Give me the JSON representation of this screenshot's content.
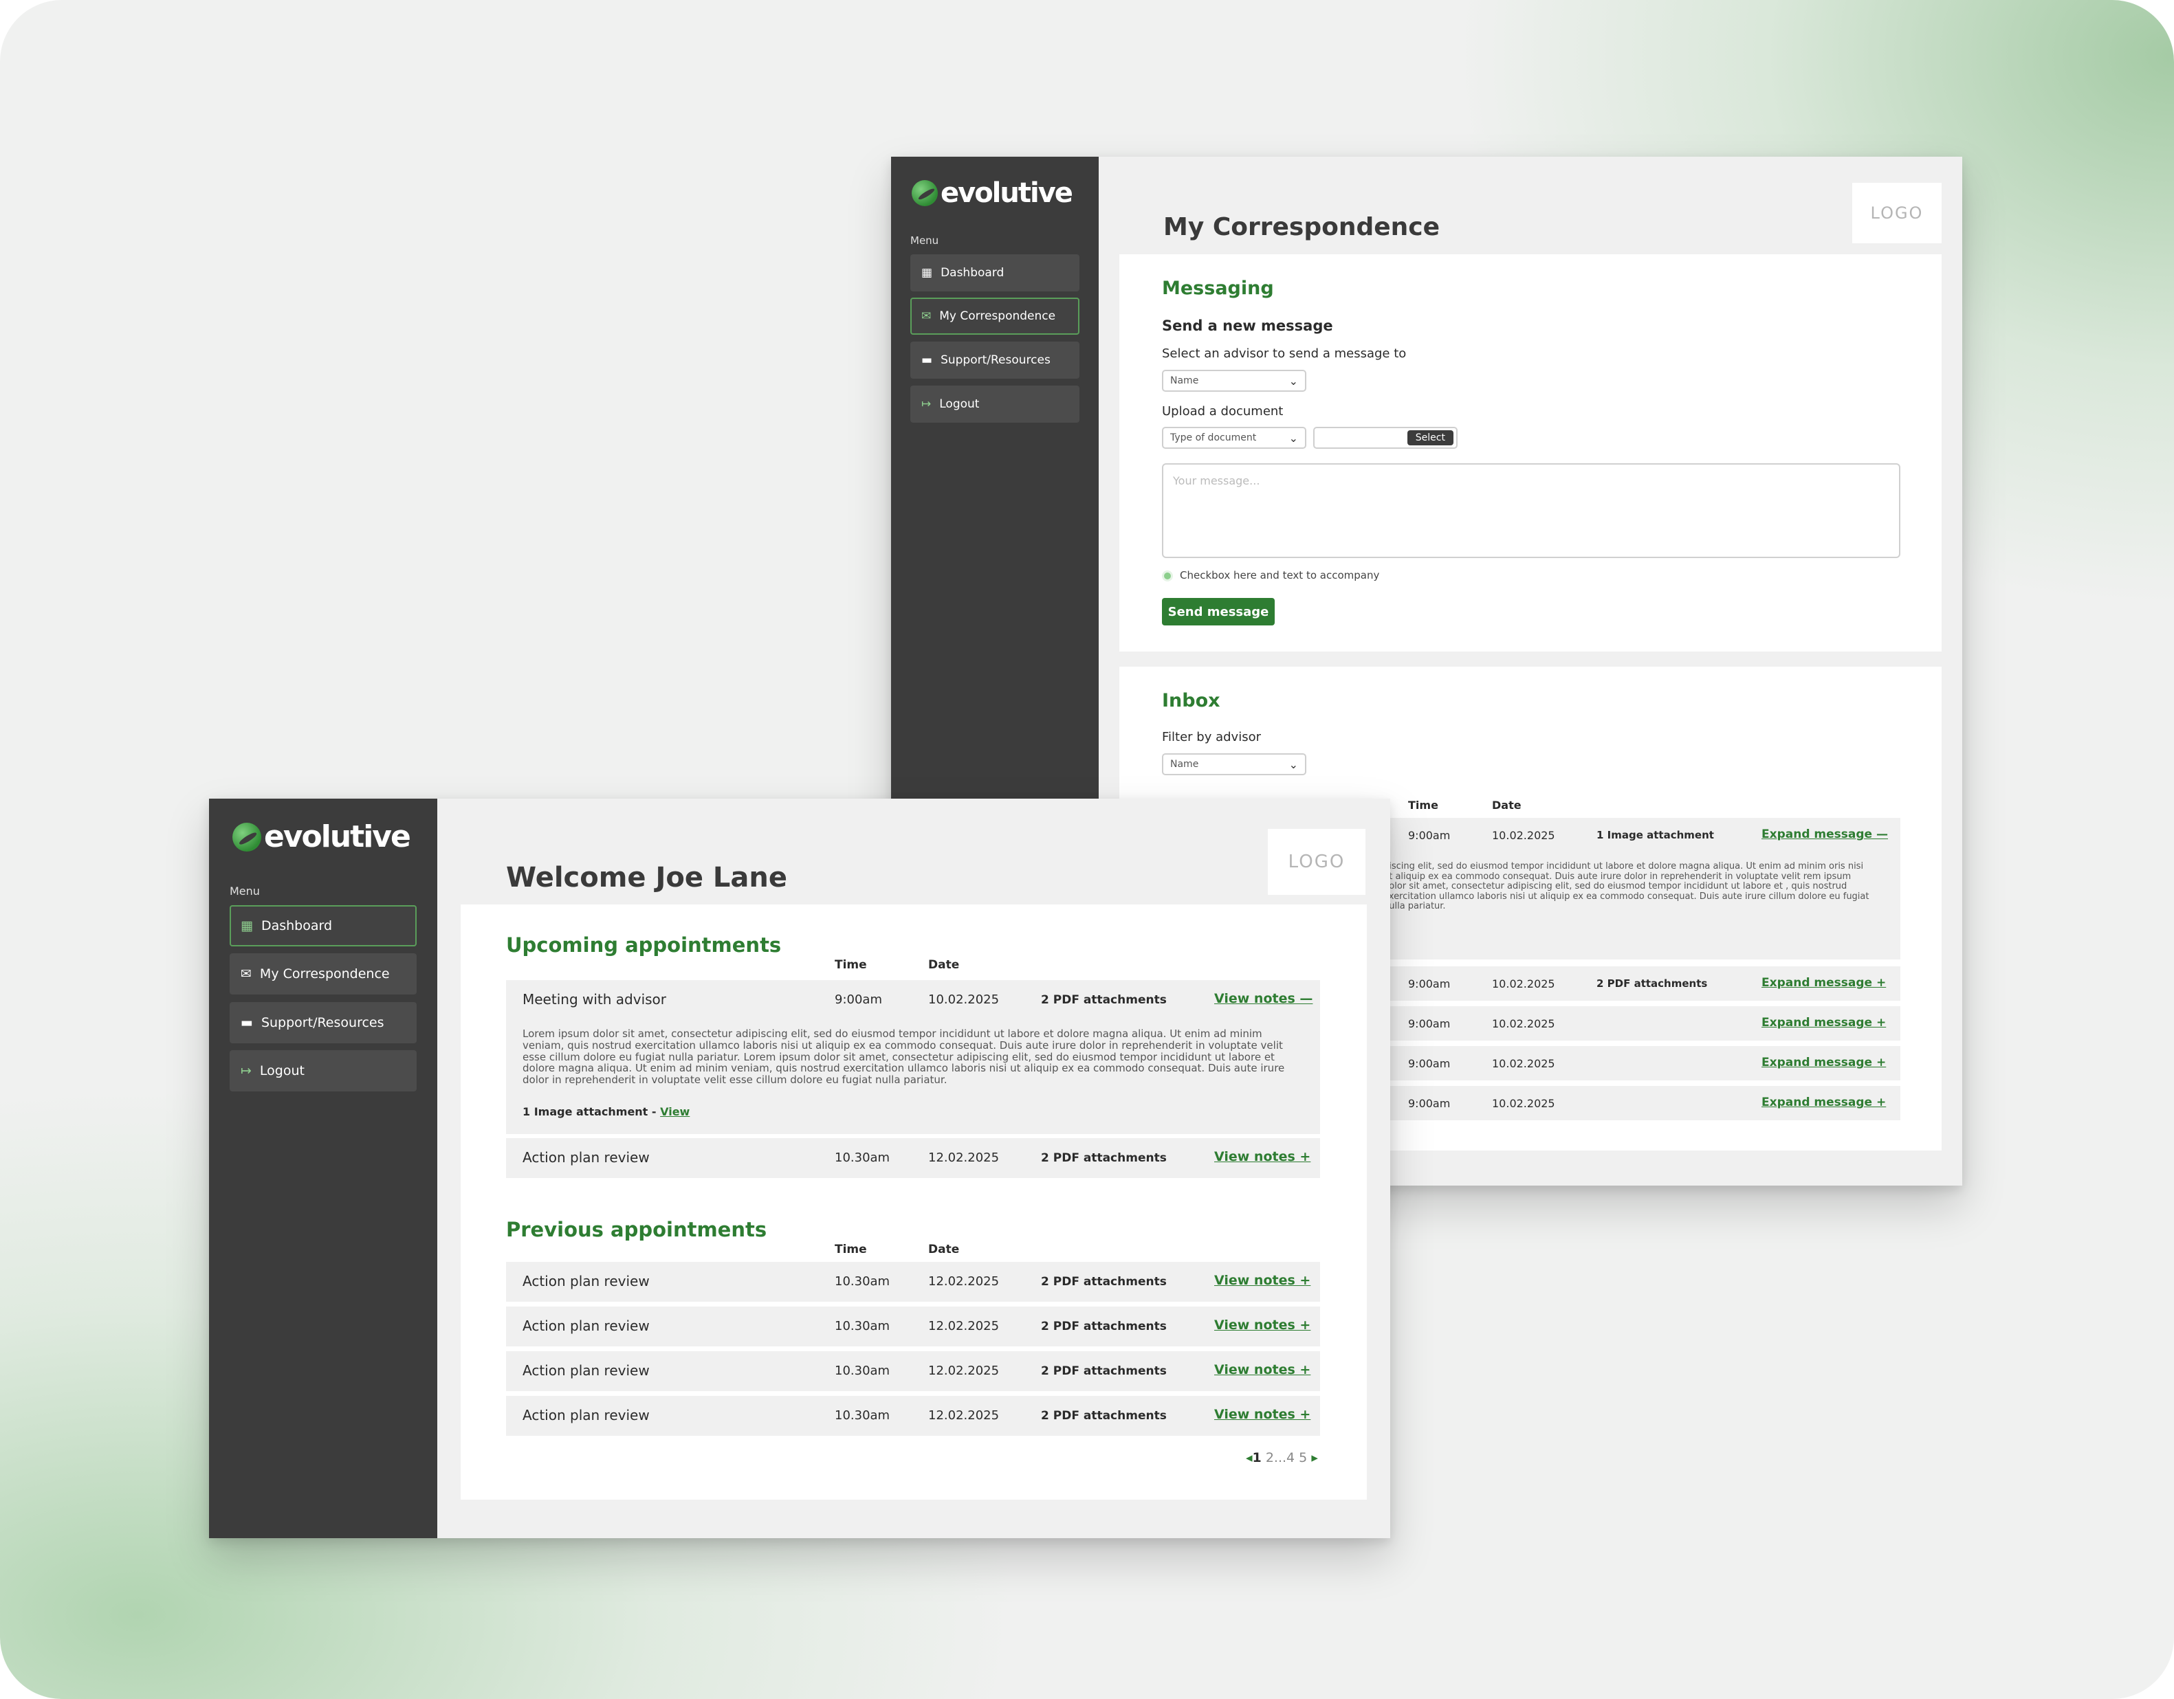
{
  "brand": {
    "name": "evolutive",
    "logo_placeholder": "LOGO"
  },
  "menu_label": "Menu",
  "back_window": {
    "nav": [
      {
        "label": "Dashboard",
        "icon": "dashboard-icon",
        "active": false
      },
      {
        "label": "My Correspondence",
        "icon": "envelope-icon",
        "active": true
      },
      {
        "label": "Support/Resources",
        "icon": "folder-icon",
        "active": false
      },
      {
        "label": "Logout",
        "icon": "logout-icon",
        "active": false
      }
    ],
    "page_title": "My Correspondence",
    "messaging": {
      "heading": "Messaging",
      "subheading": "Send a new message",
      "advisor_label": "Select an advisor to send a message to",
      "advisor_select_value": "Name",
      "upload_label": "Upload a document",
      "doc_type_select_value": "Type of document",
      "select_button": "Select",
      "message_placeholder": "Your message...",
      "checkbox_label": "Checkbox here and text to accompany",
      "send_button": "Send message"
    },
    "inbox": {
      "heading": "Inbox",
      "filter_label": "Filter by advisor",
      "filter_select_value": "Name",
      "columns": {
        "time": "Time",
        "date": "Date"
      },
      "expanded_text": "piscing elit, sed do eiusmod tempor incididunt ut labore et dolore magna aliqua. Ut enim ad minim oris nisi ut aliquip ex ea commodo consequat. Duis aute irure dolor in reprehenderit in voluptate velit rem ipsum dolor sit amet, consectetur adipiscing elit, sed do eiusmod tempor incididunt ut labore et , quis nostrud exercitation ullamco laboris nisi ut aliquip ex ea commodo consequat. Duis aute irure cillum dolore eu fugiat nulla pariatur.",
      "rows": [
        {
          "time": "9:00am",
          "date": "10.02.2025",
          "attachment": "1 Image attachment",
          "action": "Expand message —"
        },
        {
          "time": "9:00am",
          "date": "10.02.2025",
          "attachment": "2 PDF attachments",
          "action": "Expand message +"
        },
        {
          "time": "9:00am",
          "date": "10.02.2025",
          "attachment": "",
          "action": "Expand message +"
        },
        {
          "time": "9:00am",
          "date": "10.02.2025",
          "attachment": "",
          "action": "Expand message +"
        },
        {
          "time": "9:00am",
          "date": "10.02.2025",
          "attachment": "",
          "action": "Expand message +"
        }
      ]
    }
  },
  "front_window": {
    "nav": [
      {
        "label": "Dashboard",
        "icon": "dashboard-icon",
        "active": true
      },
      {
        "label": "My Correspondence",
        "icon": "envelope-icon",
        "active": false
      },
      {
        "label": "Support/Resources",
        "icon": "folder-icon",
        "active": false
      },
      {
        "label": "Logout",
        "icon": "logout-icon",
        "active": false
      }
    ],
    "page_title": "Welcome Joe Lane",
    "upcoming": {
      "heading": "Upcoming appointments",
      "columns": {
        "time": "Time",
        "date": "Date"
      },
      "expanded": {
        "title": "Meeting with advisor",
        "time": "9:00am",
        "date": "10.02.2025",
        "attachment": "2 PDF attachments",
        "action": "View notes —",
        "notes": "Lorem ipsum dolor sit amet, consectetur adipiscing elit, sed do eiusmod tempor incididunt ut labore et dolore magna aliqua. Ut enim ad minim veniam, quis nostrud exercitation ullamco laboris nisi ut aliquip ex ea commodo consequat. Duis aute irure dolor in reprehenderit in voluptate velit esse cillum dolore eu fugiat nulla pariatur. Lorem ipsum dolor sit amet, consectetur adipiscing elit, sed do eiusmod tempor incididunt ut labore et dolore magna aliqua. Ut enim ad minim veniam, quis nostrud exercitation ullamco laboris nisi ut aliquip ex ea commodo consequat. Duis aute irure dolor in reprehenderit in voluptate velit esse cillum dolore eu fugiat nulla pariatur.",
        "image_attachment": "1 Image attachment - ",
        "image_view_link": "View"
      },
      "rows": [
        {
          "title": "Action plan review",
          "time": "10.30am",
          "date": "12.02.2025",
          "attachment": "2 PDF attachments",
          "action": "View notes +"
        }
      ]
    },
    "previous": {
      "heading": "Previous appointments",
      "columns": {
        "time": "Time",
        "date": "Date"
      },
      "rows": [
        {
          "title": "Action plan review",
          "time": "10.30am",
          "date": "12.02.2025",
          "attachment": "2 PDF attachments",
          "action": "View notes +"
        },
        {
          "title": "Action plan review",
          "time": "10.30am",
          "date": "12.02.2025",
          "attachment": "2 PDF attachments",
          "action": "View notes +"
        },
        {
          "title": "Action plan review",
          "time": "10.30am",
          "date": "12.02.2025",
          "attachment": "2 PDF attachments",
          "action": "View notes +"
        },
        {
          "title": "Action plan review",
          "time": "10.30am",
          "date": "12.02.2025",
          "attachment": "2 PDF attachments",
          "action": "View notes +"
        }
      ]
    },
    "pagination": {
      "prev": "◂",
      "current": "1",
      "pages": "2...4 5",
      "next": "▸"
    }
  }
}
